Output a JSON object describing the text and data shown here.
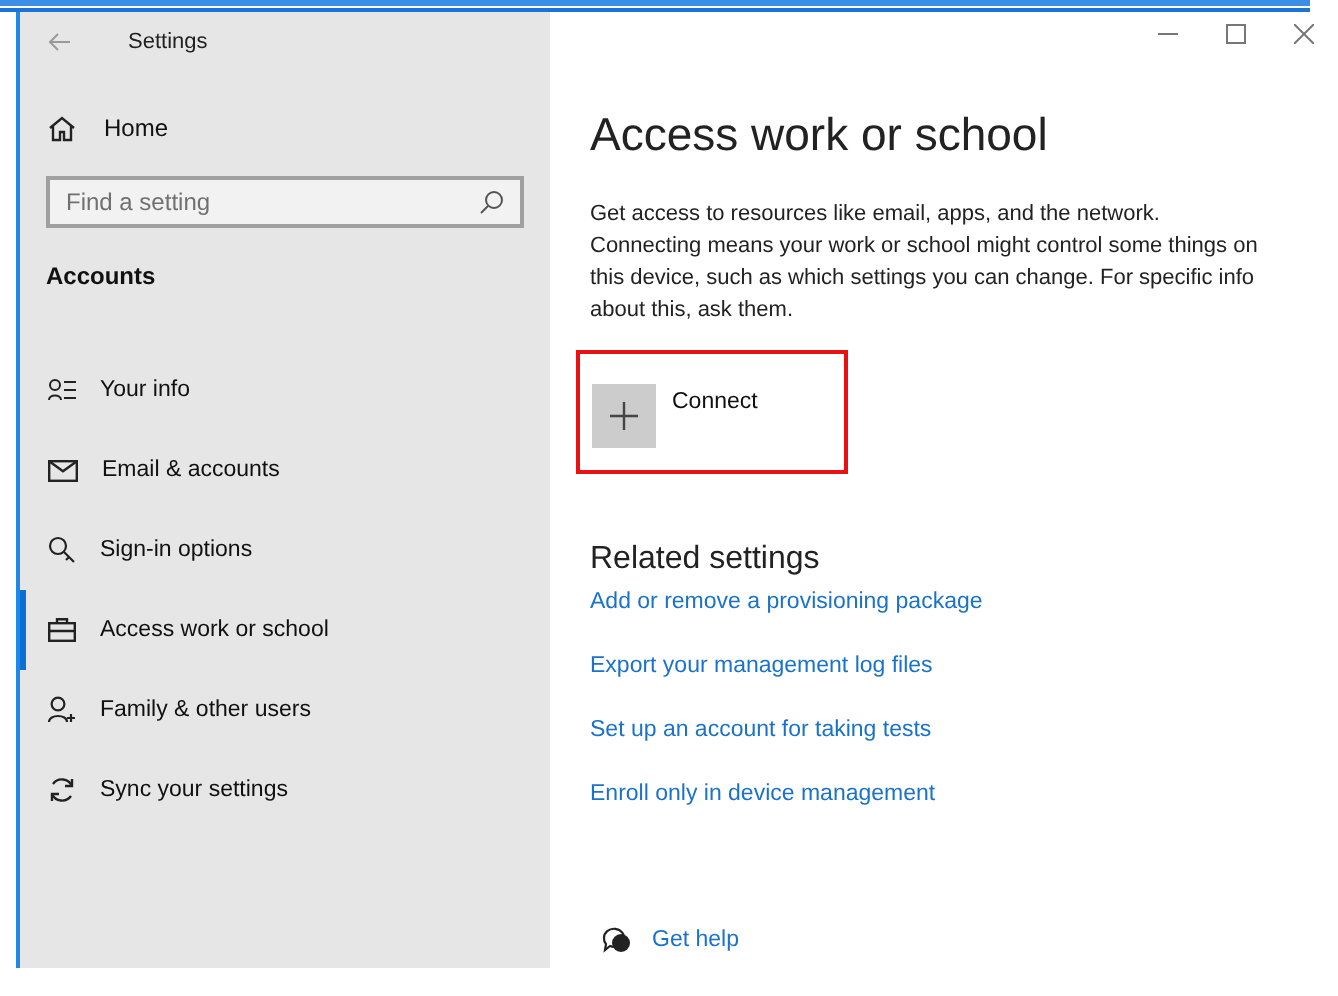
{
  "window": {
    "title": "Settings"
  },
  "sidebar": {
    "home": "Home",
    "search": {
      "placeholder": "Find a setting"
    },
    "section": "Accounts",
    "items": [
      {
        "label": "Your info",
        "selected": false
      },
      {
        "label": "Email & accounts",
        "selected": false
      },
      {
        "label": "Sign-in options",
        "selected": false
      },
      {
        "label": "Access work or school",
        "selected": true
      },
      {
        "label": "Family & other users",
        "selected": false
      },
      {
        "label": "Sync your settings",
        "selected": false
      }
    ]
  },
  "page": {
    "title": "Access work or school",
    "description": "Get access to resources like email, apps, and the network. Connecting means your work or school might control some things on this device, such as which settings you can change. For specific info about this, ask them.",
    "connect": "Connect",
    "related_title": "Related settings",
    "related_links": [
      "Add or remove a provisioning package",
      "Export your management log files",
      "Set up an account for taking tests",
      "Enroll only in device management"
    ],
    "help": "Get help"
  }
}
